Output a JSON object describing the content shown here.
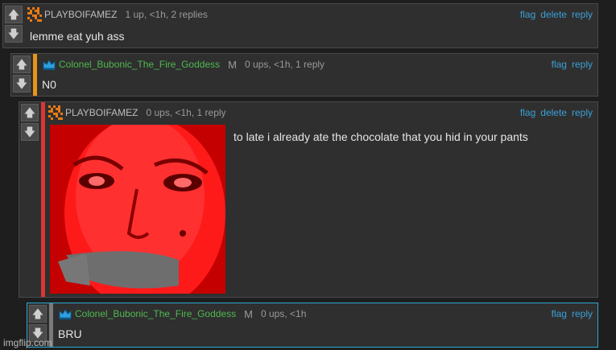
{
  "vote": {
    "up_icon": "up-arrow-icon",
    "down_icon": "down-arrow-icon"
  },
  "comments": [
    {
      "user": "PLAYBOIFAMEZ",
      "meta": "1 up, <1h, 2 replies",
      "actions": [
        "flag",
        "delete",
        "reply"
      ],
      "text": "lemme eat yuh ass"
    },
    {
      "user": "Colonel_Bubonic_The_Fire_Goddess",
      "mod": "M",
      "meta": "0 ups, <1h, 1 reply",
      "actions": [
        "flag",
        "reply"
      ],
      "text": "N0"
    },
    {
      "user": "PLAYBOIFAMEZ",
      "meta": "0 ups, <1h, 1 reply",
      "actions": [
        "flag",
        "delete",
        "reply"
      ],
      "text": "to late i already ate the chocolate that you hid in your pants"
    },
    {
      "user": "Colonel_Bubonic_The_Fire_Goddess",
      "mod": "M",
      "meta": "0 ups, <1h",
      "actions": [
        "flag",
        "reply"
      ],
      "text": "BRU"
    }
  ],
  "colors": {
    "reply_bar_orange": "#e8941a",
    "reply_bar_red": "#d93636",
    "reply_bar_grey": "#7a7a7a",
    "link": "#3aa0d8",
    "mod_name": "#4fb84f"
  },
  "watermark": "imgflip.com"
}
